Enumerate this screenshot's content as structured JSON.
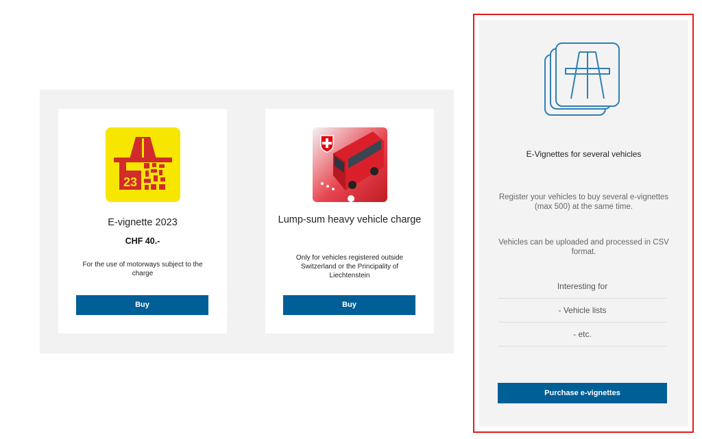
{
  "products": [
    {
      "title": "E-vignette 2023",
      "price": "CHF 40.-",
      "description": "For the use of motorways subject to the charge",
      "button_label": "Buy",
      "image_year": "23",
      "image_icon": "e-vignette-icon"
    },
    {
      "title": "Lump-sum heavy vehicle charge",
      "description": "Only for vehicles registered outside Switzerland or the Principality of Liechtenstein",
      "button_label": "Buy",
      "image_icon": "red-bus-swiss-icon"
    }
  ],
  "side_panel": {
    "icon": "motorway-cards-icon",
    "heading": "E-Vignettes for several vehicles",
    "paragraph_1": "Register your vehicles to buy several e-vignettes (max 500) at the same time.",
    "paragraph_2": "Vehicles can be uploaded and processed in CSV format.",
    "list": [
      "Interesting for",
      "- Vehicle lists",
      "- etc."
    ],
    "button_label": "Purchase e-vignettes"
  },
  "colors": {
    "button_blue": "#005f96",
    "highlight_red": "#e31b1b",
    "vignette_yellow": "#f6e600",
    "vignette_red": "#d22b2b",
    "bus_red": "#d9202a"
  }
}
